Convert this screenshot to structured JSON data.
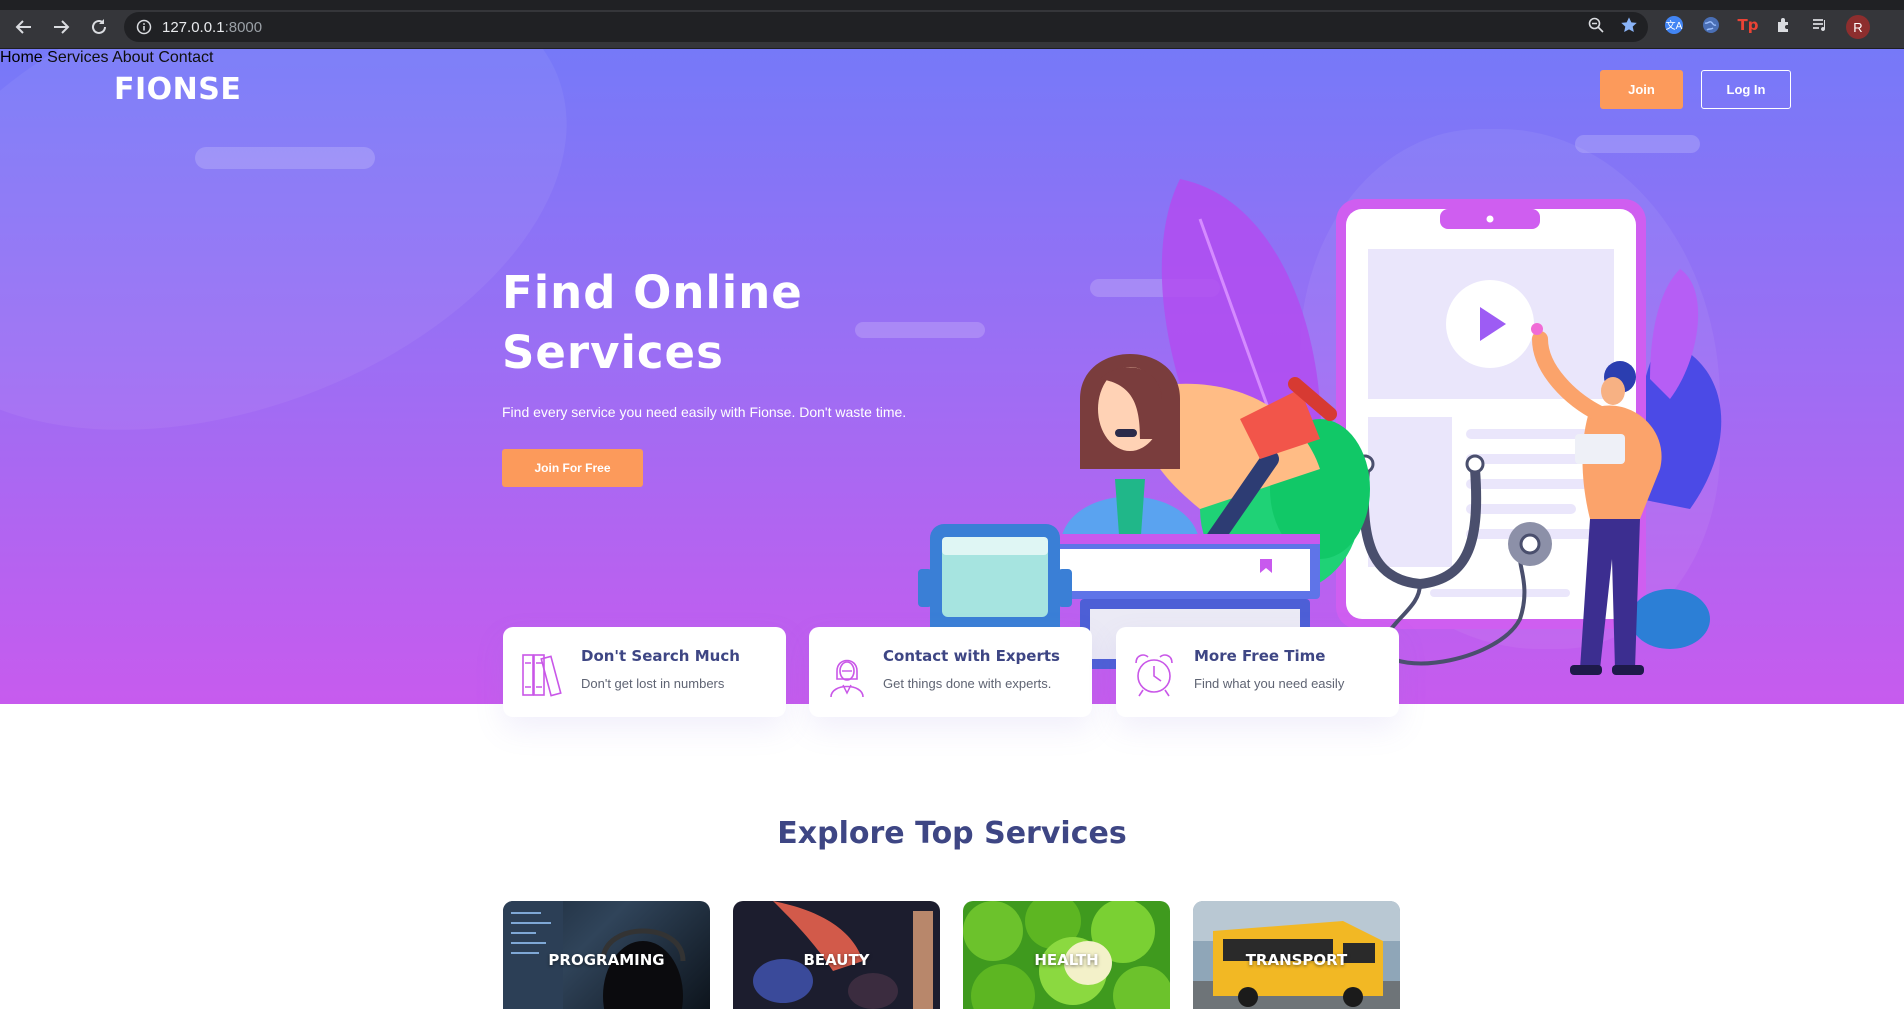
{
  "browser": {
    "url_host": "127.0.0.1",
    "url_port": ":8000",
    "profile_initial": "R",
    "icons": [
      "back-icon",
      "forward-icon",
      "reload-icon",
      "info-icon",
      "zoom-icon",
      "star-icon",
      "translate-icon",
      "globe-icon",
      "tp-extension-icon",
      "puzzle-icon",
      "media-icon"
    ],
    "extension_tp_label": "Tp"
  },
  "header": {
    "logo": "FIONSE",
    "nav": [
      "Home",
      "Services",
      "About",
      "Contact"
    ],
    "join_label": "Join",
    "login_label": "Log In"
  },
  "hero": {
    "title_line1": "Find Online",
    "title_line2": "Services",
    "subtitle": "Find every service you need easily with Fionse. Don't waste time.",
    "cta_label": "Join For Free",
    "accent_color": "#fc9a5b"
  },
  "features": [
    {
      "title": "Don't Search Much",
      "description": "Don't get lost in numbers",
      "icon": "books-icon"
    },
    {
      "title": "Contact with Experts",
      "description": "Get things done with experts.",
      "icon": "expert-icon"
    },
    {
      "title": "More Free Time",
      "description": "Find what you need easily",
      "icon": "alarm-clock-icon"
    }
  ],
  "explore": {
    "title": "Explore Top Services",
    "services": [
      "PROGRAMING",
      "BEAUTY",
      "HEALTH",
      "TRANSPORT"
    ]
  }
}
